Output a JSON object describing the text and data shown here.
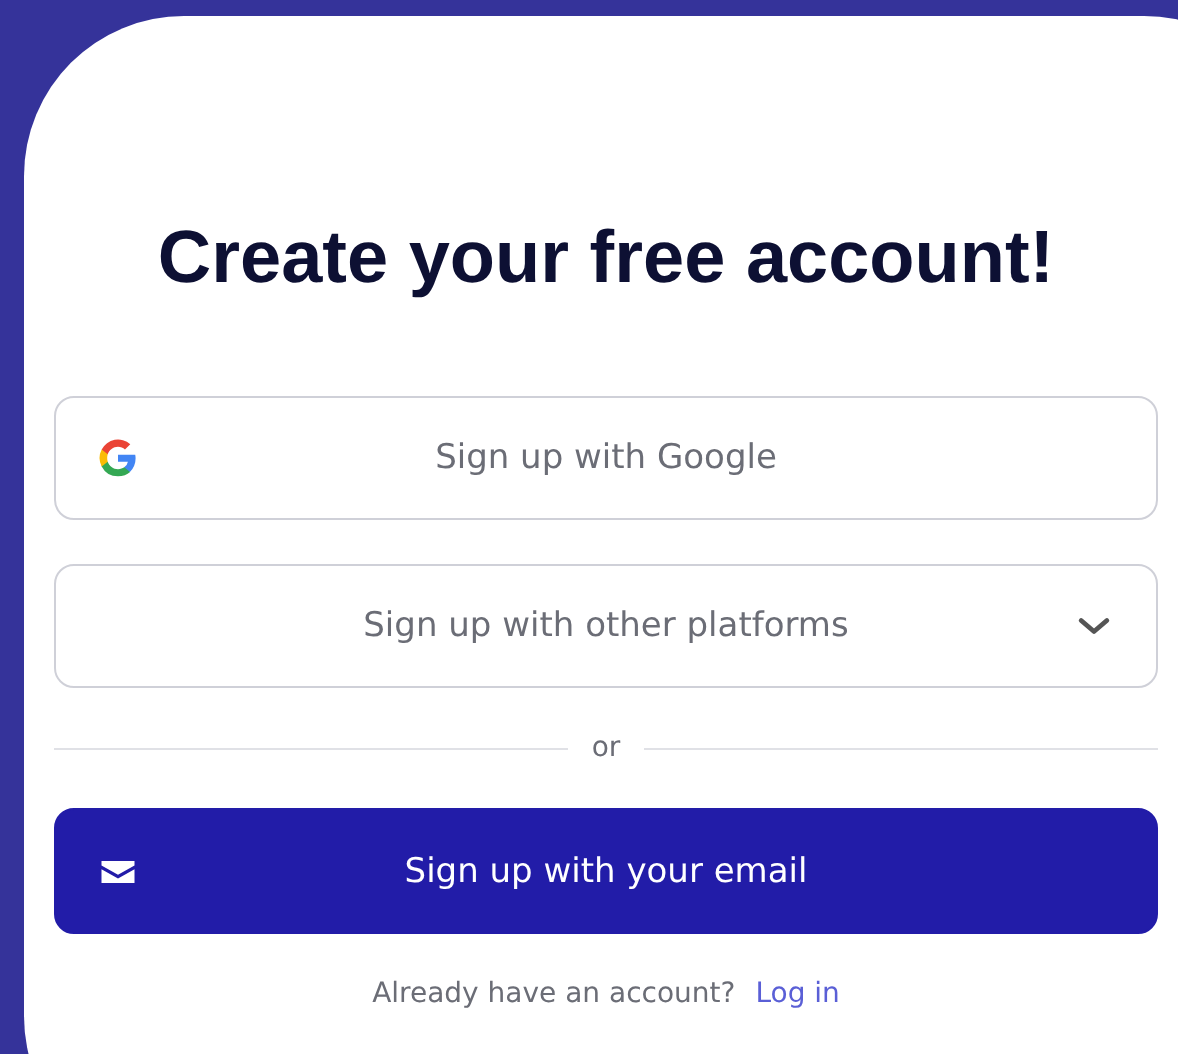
{
  "title": "Create your free account!",
  "buttons": [
    {
      "kind": "google",
      "label": "Sign up with Google"
    },
    {
      "kind": "dropdown",
      "label": "Sign up with other platforms"
    },
    {
      "kind": "divider",
      "label": "or"
    },
    {
      "kind": "email",
      "label": "Sign up with your email"
    }
  ],
  "footer": {
    "text": "Already have an account?",
    "link": "Log in"
  }
}
